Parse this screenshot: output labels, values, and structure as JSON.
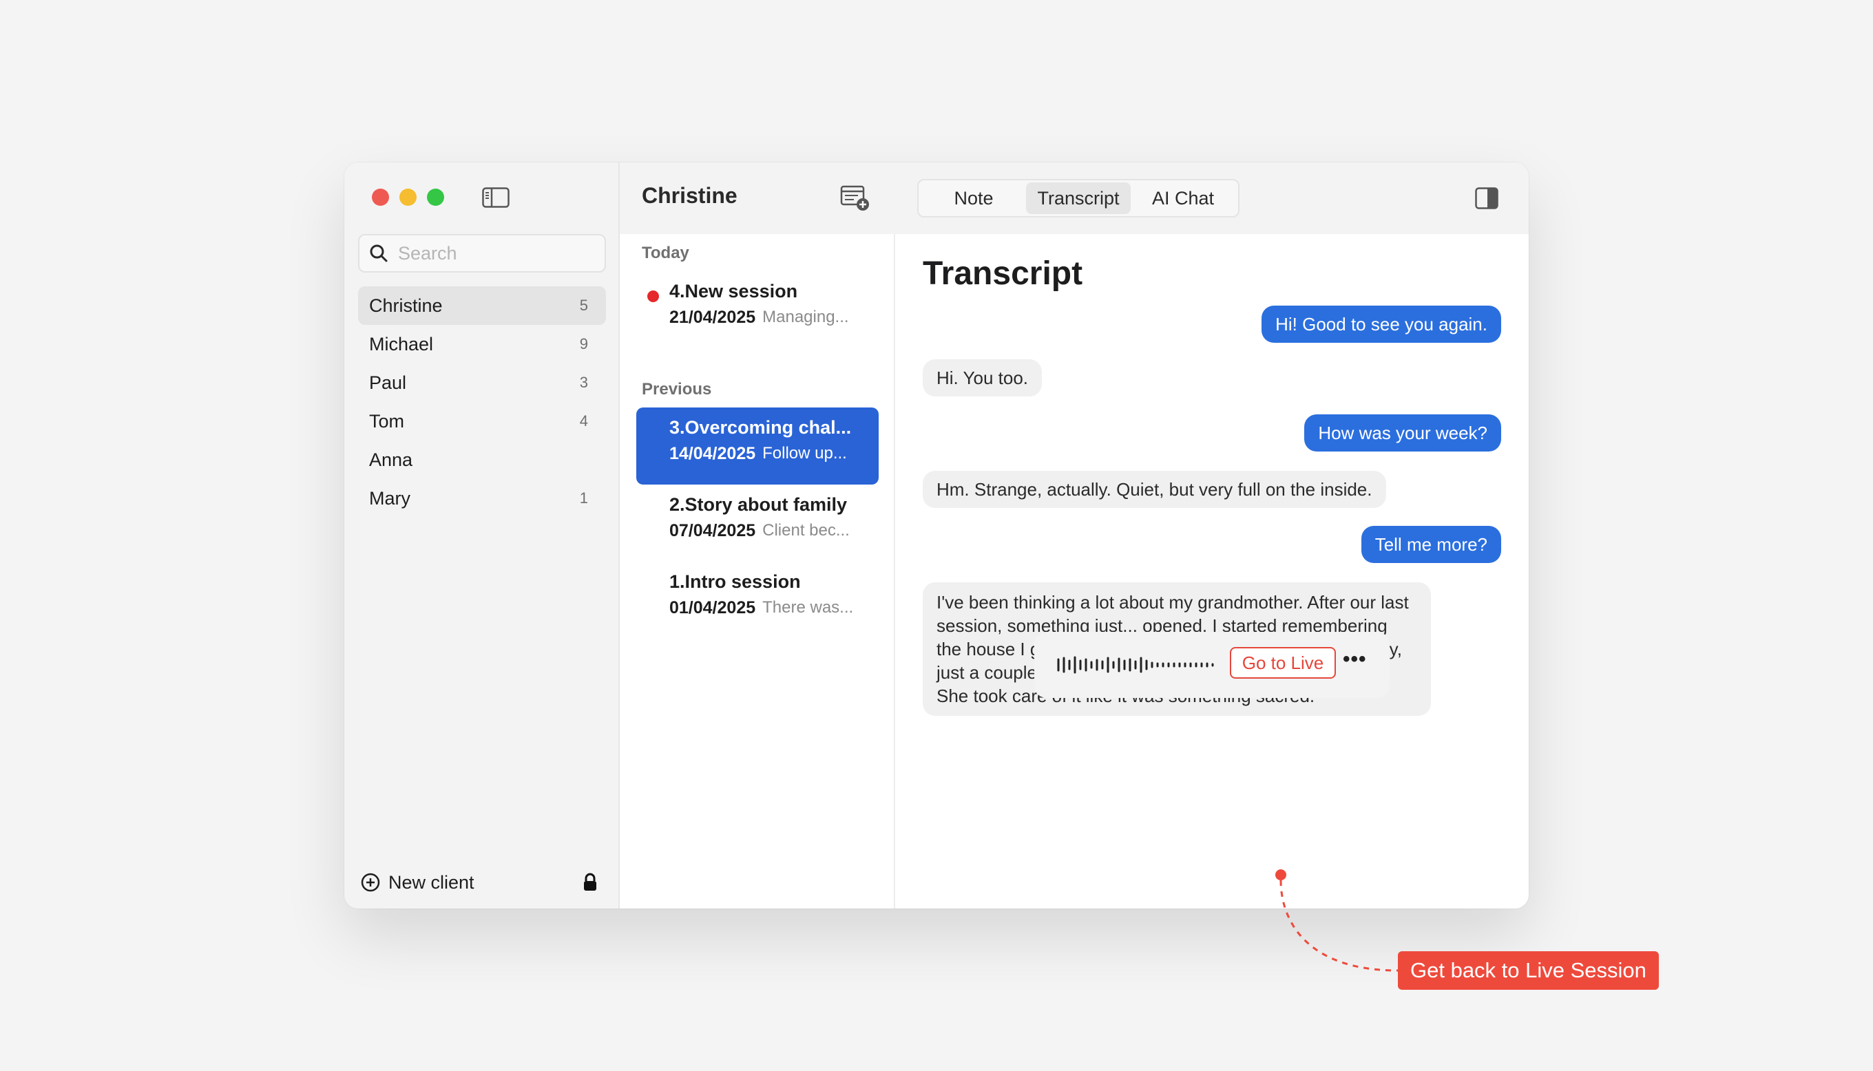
{
  "sidebar": {
    "search_placeholder": "Search",
    "clients": [
      {
        "name": "Christine",
        "count": "5"
      },
      {
        "name": "Michael",
        "count": "9"
      },
      {
        "name": "Paul",
        "count": "3"
      },
      {
        "name": "Tom",
        "count": "4"
      },
      {
        "name": "Anna",
        "count": ""
      },
      {
        "name": "Mary",
        "count": "1"
      }
    ],
    "new_client_label": "New client"
  },
  "sessions": {
    "client_name": "Christine",
    "today_label": "Today",
    "previous_label": "Previous",
    "today": [
      {
        "title": "4.New session",
        "date": "21/04/2025",
        "preview": "Managing..."
      }
    ],
    "previous": [
      {
        "title": "3.Overcoming chal...",
        "date": "14/04/2025",
        "preview": "Follow up..."
      },
      {
        "title": "2.Story about family",
        "date": "07/04/2025",
        "preview": "Client bec..."
      },
      {
        "title": "1.Intro session",
        "date": "01/04/2025",
        "preview": "There was..."
      }
    ]
  },
  "tabs": [
    {
      "label": "Note"
    },
    {
      "label": "Transcript"
    },
    {
      "label": "AI Chat"
    }
  ],
  "transcript": {
    "title": "Transcript",
    "messages": [
      {
        "from": "therapist",
        "text": "Hi! Good to see you again."
      },
      {
        "from": "client",
        "text": "Hi. You too."
      },
      {
        "from": "therapist",
        "text": "How was your week?"
      },
      {
        "from": "client",
        "text": "Hm. Strange, actually. Quiet, but very full on the inside."
      },
      {
        "from": "therapist",
        "text": "Tell me more?"
      },
      {
        "from": "client",
        "text": "I've been thinking a lot about my grandmother. After our last session, something just... opened. I started remembering the house I grew up in. It had this little garden — not fancy, just a couple of currant bushes, some mint, wild poppies. She took care of it like it was something sacred."
      }
    ]
  },
  "player": {
    "go_live_label": "Go to Live",
    "more_label": "•••"
  },
  "annotation": {
    "callout_text": "Get back to Live Session"
  },
  "colors": {
    "accent_blue": "#2b6fde",
    "selected_session": "#2a63d6",
    "live_red": "#e5282a",
    "callout_red": "#ee4a3c"
  }
}
